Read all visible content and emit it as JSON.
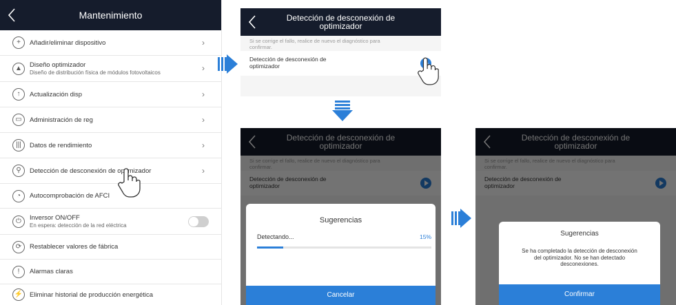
{
  "left": {
    "title": "Mantenimiento",
    "items": [
      {
        "icon": "plus-circle-icon",
        "label": "Añadir/eliminar dispositivo",
        "chevron": true
      },
      {
        "icon": "layout-icon",
        "label": "Diseño optimizador",
        "sub": "Diseño de distribución física de módulos fotovoltaicos",
        "chevron": true
      },
      {
        "icon": "upgrade-icon",
        "label": "Actualización disp",
        "chevron": true
      },
      {
        "icon": "log-icon",
        "label": "Administración de reg",
        "chevron": true
      },
      {
        "icon": "performance-icon",
        "label": "Datos de rendimiento",
        "chevron": true
      },
      {
        "icon": "optimizer-detect-icon",
        "label": "Detección de desconexión de optimizador",
        "chevron": true
      },
      {
        "icon": "afci-icon",
        "label": "Autocomprobación de AFCI",
        "chevron": false
      },
      {
        "icon": "power-icon",
        "label": "Inversor ON/OFF",
        "sub": "En espera: detección de la red eléctrica",
        "toggle": true
      },
      {
        "icon": "reset-icon",
        "label": "Restablecer valores de fábrica",
        "chevron": false
      },
      {
        "icon": "alarm-icon",
        "label": "Alarmas claras",
        "chevron": false
      },
      {
        "icon": "energy-icon",
        "label": "Eliminar historial de producción energética",
        "chevron": false
      }
    ]
  },
  "screen": {
    "title_line1": "Detección de desconexión de",
    "title_line2": "optimizador",
    "note_line1": "Si se corrige el fallo, realice de nuevo el diagnóstico para",
    "note_line2": "confirmar.",
    "item_line1": "Detección de desconexión de",
    "item_line2": "optimizador"
  },
  "dialog_progress": {
    "title": "Sugerencias",
    "status": "Detectando...",
    "percent_text": "15%",
    "progress": 0.15,
    "button": "Cancelar"
  },
  "dialog_done": {
    "title": "Sugerencias",
    "message_line1": "Se ha completado la detección de desconexión",
    "message_line2": "del optimizador. No se han detectado",
    "message_line3": "desconexiones.",
    "button": "Confirmar"
  },
  "colors": {
    "header": "#151c2c",
    "accent": "#2b7fd8"
  }
}
